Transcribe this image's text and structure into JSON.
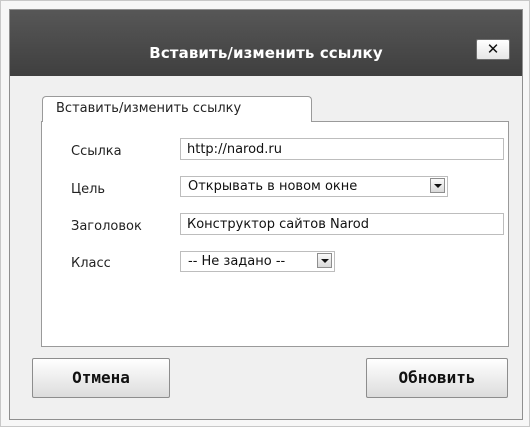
{
  "dialog": {
    "title": "Вставить/изменить ссылку",
    "close_label": "✕"
  },
  "tab": {
    "label": "Вставить/изменить ссылку"
  },
  "form": {
    "url": {
      "label": "Ссылка",
      "value": "http://narod.ru"
    },
    "target": {
      "label": "Цель",
      "selected": "Открывать в новом окне"
    },
    "title": {
      "label": "Заголовок",
      "value": "Конструктор сайтов Narod"
    },
    "class": {
      "label": "Класс",
      "selected": "-- Не задано --"
    }
  },
  "buttons": {
    "cancel": "Отмена",
    "update": "Обновить"
  }
}
